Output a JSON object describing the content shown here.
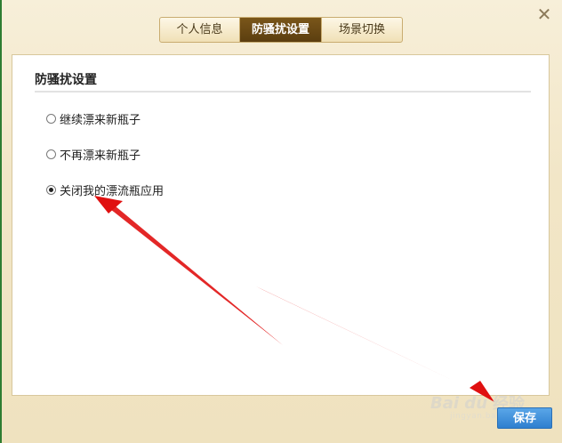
{
  "tabs": [
    {
      "label": "个人信息",
      "active": false
    },
    {
      "label": "防骚扰设置",
      "active": true
    },
    {
      "label": "场景切换",
      "active": false
    }
  ],
  "close_icon": "close-icon",
  "panel": {
    "title": "防骚扰设置",
    "options": [
      {
        "label": "继续漂来新瓶子",
        "checked": false
      },
      {
        "label": "不再漂来新瓶子",
        "checked": false
      },
      {
        "label": "关闭我的漂流瓶应用",
        "checked": true
      }
    ]
  },
  "footer": {
    "save_label": "保存"
  },
  "watermark": {
    "logo": "Bai du",
    "text": "经验",
    "sub": "jingyan.baidu.com"
  },
  "colors": {
    "background": "#f2e6c7",
    "active_tab": "#5b3e0f",
    "arrow": "#e01010",
    "save_button": "#2e7fcf"
  }
}
